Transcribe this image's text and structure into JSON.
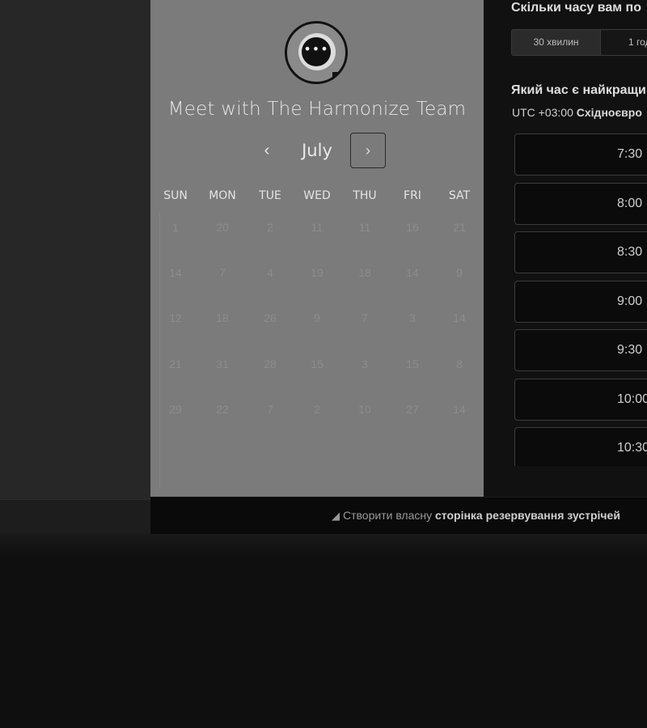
{
  "booking": {
    "title": "Meet with The Harmonize Team",
    "logo_icon": "chat-bubble-icon",
    "logo_glyph": "•••",
    "month_label": "July",
    "prev_glyph": "‹",
    "next_glyph": "›",
    "weekdays": [
      "SUN",
      "MON",
      "TUE",
      "WED",
      "THU",
      "FRI",
      "SAT"
    ],
    "weeks": [
      [
        "1",
        "20",
        "2",
        "11",
        "11",
        "16",
        "21"
      ],
      [
        "14",
        "7",
        "4",
        "19",
        "18",
        "14",
        "9"
      ],
      [
        "12",
        "18",
        "26",
        "9",
        "7",
        "3",
        "14"
      ],
      [
        "21",
        "31",
        "28",
        "15",
        "3",
        "15",
        "8"
      ],
      [
        "29",
        "22",
        "7",
        "2",
        "10",
        "27",
        "14"
      ]
    ]
  },
  "scheduler": {
    "duration_heading": "Скільки часу вам по",
    "durations": [
      "30 хвилин",
      "1 год"
    ],
    "time_heading": "Який час є найкращи",
    "tz_offset": "UTC +03:00",
    "tz_name": "Східноєвро",
    "slots": [
      "7:30",
      "8:00",
      "8:30",
      "9:00",
      "9:30",
      "10:00",
      "10:30"
    ]
  },
  "footer": {
    "icon": "harmonize-logo-icon",
    "prefix": "Створити власну",
    "link": "сторінка резервування зустрічей"
  },
  "colors": {
    "panel_bg": "#7b7b7b",
    "page_bg": "#111111",
    "text_light": "#e6e6e6"
  }
}
